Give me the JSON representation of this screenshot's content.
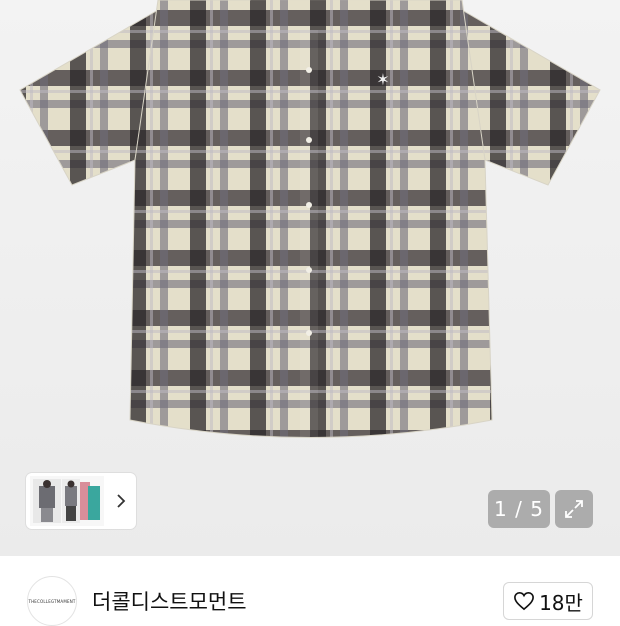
{
  "gallery": {
    "current_page": 1,
    "total_pages": 5,
    "counter_text": "1 / 5",
    "product_colors": {
      "cream": "#e6e1cc",
      "charcoal": "#2f2a2e",
      "grey": "#7d7a86"
    }
  },
  "thumbnails": {
    "next_icon": "chevron-right-icon"
  },
  "store": {
    "logo_text": "THECOLLEGTMAMENT",
    "name": "더콜디스트모먼트",
    "like_count": "18만",
    "like_icon": "heart-outline-icon"
  }
}
